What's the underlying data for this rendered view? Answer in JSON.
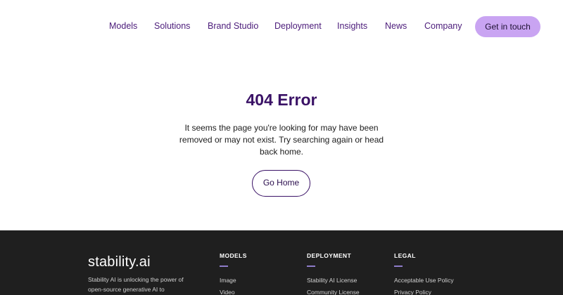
{
  "header": {
    "nav": [
      "Models",
      "Solutions",
      "Brand Studio",
      "Deployment",
      "Insights",
      "News",
      "Company"
    ],
    "cta_label": "Get in touch"
  },
  "main": {
    "title": "404 Error",
    "description": "It seems the page you're looking for may have been removed or may not exist. Try searching again or head back home.",
    "button_label": "Go Home"
  },
  "footer": {
    "logo": "stability.ai",
    "tagline": "Stability AI is unlocking the power of open-source generative AI to",
    "columns": [
      {
        "heading": "MODELS",
        "links": [
          "Image",
          "Video"
        ]
      },
      {
        "heading": "DEPLOYMENT",
        "links": [
          "Stability AI License",
          "Community License"
        ]
      },
      {
        "heading": "LEGAL",
        "links": [
          "Acceptable Use Policy",
          "Privacy Policy"
        ]
      }
    ]
  },
  "colors": {
    "accent_purple": "#3a1266",
    "cta_background": "#c9a4f2",
    "footer_background": "#1f1f1f"
  }
}
